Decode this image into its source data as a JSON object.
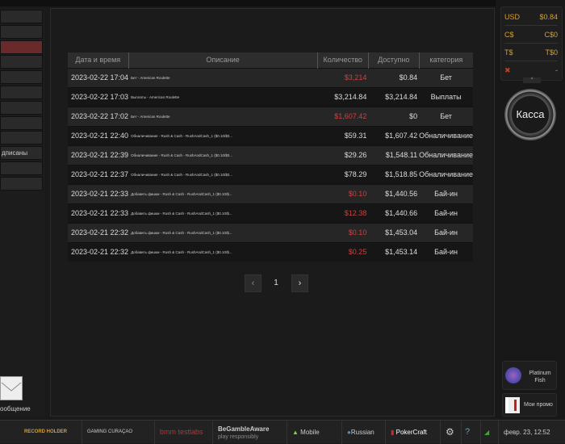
{
  "sidebar": {
    "items": [
      "",
      "",
      "",
      "",
      "",
      "",
      "",
      "",
      "",
      "дписаны",
      "",
      ""
    ],
    "active_index": 2,
    "message_label": "ообщение"
  },
  "table": {
    "headers": [
      "Дата и время",
      "Описание",
      "Количество",
      "Доступно",
      "категория"
    ],
    "rows": [
      {
        "date": "2023-02-22 17:04",
        "desc": "Бет - American Roulette",
        "qty": "$3,214",
        "avail": "$0.84",
        "cat": "Бет",
        "neg": true
      },
      {
        "date": "2023-02-22 17:03",
        "desc": "Выплаты - American Roulette",
        "qty": "$3,214.84",
        "avail": "$3,214.84",
        "cat": "Выплаты",
        "neg": false
      },
      {
        "date": "2023-02-22 17:02",
        "desc": "Бет - American Roulette",
        "qty": "$1,607.42",
        "avail": "$0",
        "cat": "Бет",
        "neg": true
      },
      {
        "date": "2023-02-21 22:40",
        "desc": "Обналичивание - Rush & Cash - RushAndCash_1 ($0.10/$0...",
        "qty": "$59.31",
        "avail": "$1,607.42",
        "cat": "Обналичивание",
        "neg": false
      },
      {
        "date": "2023-02-21 22:39",
        "desc": "Обналичивание - Rush & Cash - RushAndCash_1 ($0.10/$0...",
        "qty": "$29.26",
        "avail": "$1,548.11",
        "cat": "Обналичивание",
        "neg": false
      },
      {
        "date": "2023-02-21 22:37",
        "desc": "Обналичивание - Rush & Cash - RushAndCash_1 ($0.10/$0...",
        "qty": "$78.29",
        "avail": "$1,518.85",
        "cat": "Обналичивание",
        "neg": false
      },
      {
        "date": "2023-02-21 22:33",
        "desc": "Добавить фишки - Rush & Cash - RushAndCash_1 ($0.10/$...",
        "qty": "$0.10",
        "avail": "$1,440.56",
        "cat": "Бай-ин",
        "neg": true
      },
      {
        "date": "2023-02-21 22:33",
        "desc": "Добавить фишки - Rush & Cash - RushAndCash_1 ($0.10/$...",
        "qty": "$12.38",
        "avail": "$1,440.66",
        "cat": "Бай-ин",
        "neg": true
      },
      {
        "date": "2023-02-21 22:32",
        "desc": "Добавить фишки - Rush & Cash - RushAndCash_1 ($0.10/$...",
        "qty": "$0.10",
        "avail": "$1,453.04",
        "cat": "Бай-ин",
        "neg": true
      },
      {
        "date": "2023-02-21 22:32",
        "desc": "Добавить фишки - Rush & Cash - RushAndCash_1 ($0.10/$...",
        "qty": "$0.25",
        "avail": "$1,453.14",
        "cat": "Бай-ин",
        "neg": true
      }
    ]
  },
  "pagination": {
    "prev": "‹",
    "page": "1",
    "next": "›"
  },
  "balance": [
    {
      "cur": "USD",
      "val": "$0.84"
    },
    {
      "cur": "C$",
      "val": "C$0"
    },
    {
      "cur": "T$",
      "val": "T$0"
    },
    {
      "cur": "",
      "val": "-",
      "icon": "ticket-icon"
    }
  ],
  "cashier_label": "Касса",
  "platinum_label": "Platinum Fish",
  "promo_label": "Мои промо",
  "footer": {
    "record": "RECORD HOLDER",
    "curacao": "GAMING CURAÇAO",
    "bmm": "bmm testlabs",
    "gamble_title": "BeGambleAware",
    "gamble_sub": "play responsibly",
    "mobile": "Mobile",
    "language": "Russian",
    "pokercraft": "PokerCraft",
    "datetime": "февр. 23, 12:52"
  },
  "colors": {
    "negative": "#d04040",
    "active_nav": "#6a2a2a",
    "gold": "#d4a030"
  }
}
